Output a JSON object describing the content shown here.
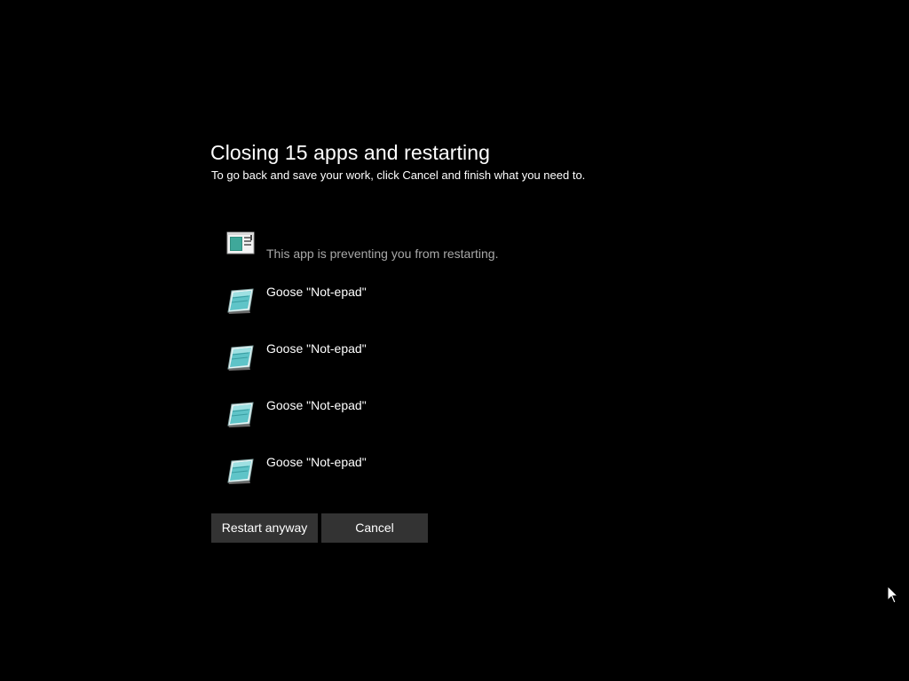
{
  "dialog": {
    "title": "Closing 15 apps and restarting",
    "subtitle": "To go back and save your work, click Cancel and finish what you need to."
  },
  "blocking_app": {
    "icon": "window-app-icon",
    "message": "This app is preventing you from restarting."
  },
  "apps": [
    {
      "name": "Goose \"Not-epad\"",
      "icon": "notepad-icon"
    },
    {
      "name": "Goose \"Not-epad\"",
      "icon": "notepad-icon"
    },
    {
      "name": "Goose \"Not-epad\"",
      "icon": "notepad-icon"
    },
    {
      "name": "Goose \"Not-epad\"",
      "icon": "notepad-icon"
    }
  ],
  "buttons": {
    "restart_label": "Restart anyway",
    "cancel_label": "Cancel"
  },
  "colors": {
    "background": "#000000",
    "button_bg": "#333333",
    "text": "#ffffff",
    "muted_text": "#a8a8a8"
  }
}
